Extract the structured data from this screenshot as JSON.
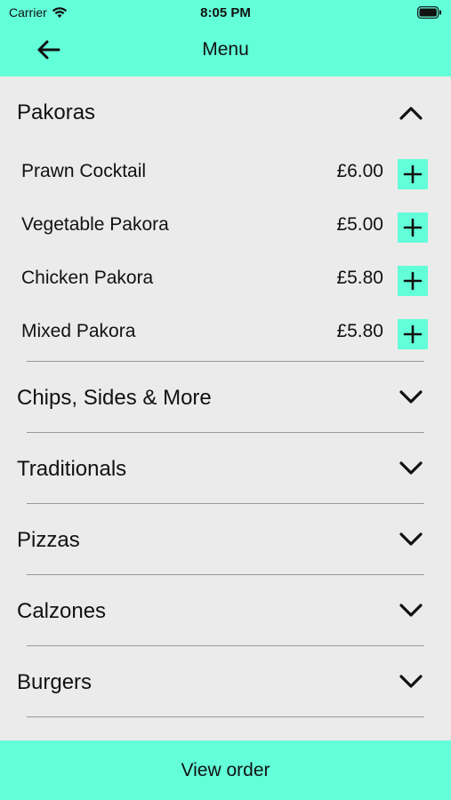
{
  "status": {
    "carrier": "Carrier",
    "time": "8:05 PM"
  },
  "nav": {
    "title": "Menu"
  },
  "expanded": {
    "title": "Pakoras",
    "items": [
      {
        "name": "Prawn Cocktail",
        "price": "£6.00"
      },
      {
        "name": "Vegetable Pakora",
        "price": "£5.00"
      },
      {
        "name": "Chicken Pakora",
        "price": "£5.80"
      },
      {
        "name": "Mixed Pakora",
        "price": "£5.80"
      }
    ]
  },
  "categories": [
    {
      "title": "Chips, Sides & More"
    },
    {
      "title": "Traditionals"
    },
    {
      "title": "Pizzas"
    },
    {
      "title": "Calzones"
    },
    {
      "title": "Burgers"
    }
  ],
  "footer": {
    "button_label": "View order"
  },
  "colors": {
    "accent": "#63ffd9",
    "background": "#ebebeb"
  }
}
